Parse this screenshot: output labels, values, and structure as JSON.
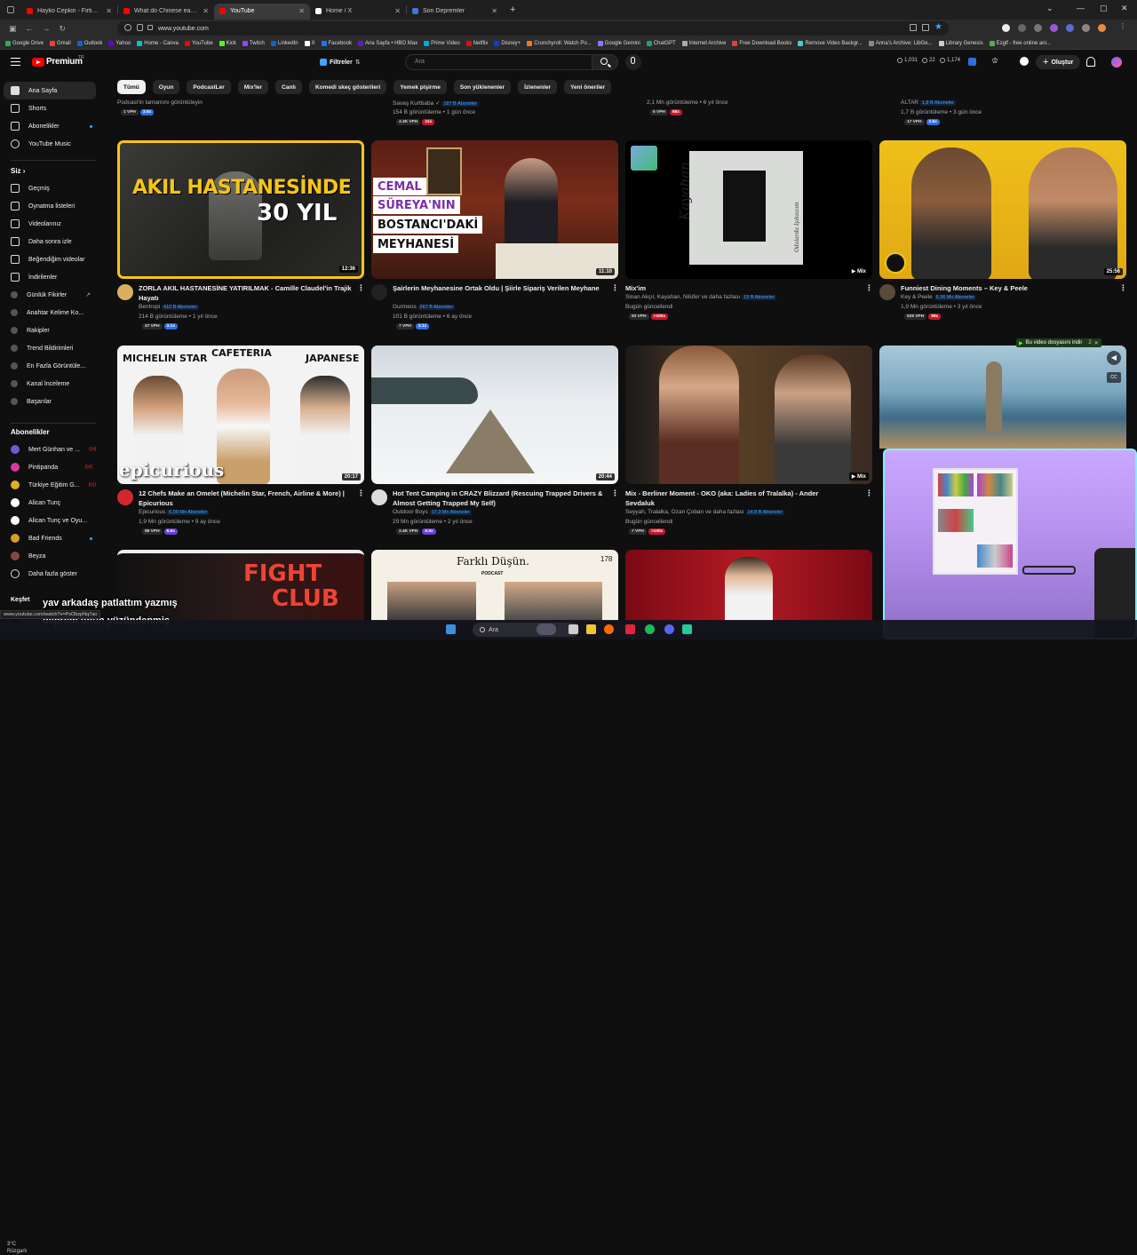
{
  "browser": {
    "tabs": [
      {
        "label": "Hayko Cepkin - Firtinam - YouTu",
        "favicon_color": "#ff0000",
        "active": false
      },
      {
        "label": "What do Chinese eat for Breakf",
        "favicon_color": "#ff0000",
        "active": false
      },
      {
        "label": "YouTube",
        "favicon_color": "#ff0000",
        "active": true
      },
      {
        "label": "Home / X",
        "favicon_color": "#ffffff",
        "active": false
      },
      {
        "label": "Son Depremler",
        "favicon_color": "#3a7bd5",
        "active": false
      }
    ],
    "new_tab": "+",
    "url": "www.youtube.com",
    "bookmarks": [
      {
        "label": "Google Drive",
        "color": "#34a853"
      },
      {
        "label": "Gmail",
        "color": "#ea4335"
      },
      {
        "label": "Outlook",
        "color": "#0a64d6"
      },
      {
        "label": "Yahoo",
        "color": "#6001d2"
      },
      {
        "label": "Home - Canva",
        "color": "#00c4cc"
      },
      {
        "label": "YouTube",
        "color": "#ff0000"
      },
      {
        "label": "Kick",
        "color": "#53fc18"
      },
      {
        "label": "Twitch",
        "color": "#9146ff"
      },
      {
        "label": "LinkedIn",
        "color": "#0a66c2"
      },
      {
        "label": "X",
        "color": "#ffffff"
      },
      {
        "label": "Facebook",
        "color": "#1877f2"
      },
      {
        "label": "Ana Sayfa • HBO Max",
        "color": "#5822b4"
      },
      {
        "label": "Prime Video",
        "color": "#00a8e1"
      },
      {
        "label": "Netflix",
        "color": "#e50914"
      },
      {
        "label": "Disney+",
        "color": "#113ccf"
      },
      {
        "label": "Crunchyroll: Watch Po...",
        "color": "#f47521"
      },
      {
        "label": "Google Gemini",
        "color": "#8e75ff"
      },
      {
        "label": "ChatGPT",
        "color": "#10a37f"
      },
      {
        "label": "Internet Archive",
        "color": "#aaaaaa"
      },
      {
        "label": "Free Download Books",
        "color": "#e04040"
      },
      {
        "label": "Remove Video Backgr...",
        "color": "#4cc"
      },
      {
        "label": "Anna's Archive: LibGe...",
        "color": "#888888"
      },
      {
        "label": "Library Genesis",
        "color": "#cccccc"
      },
      {
        "label": "Ezgif - free online ani...",
        "color": "#55aa55"
      }
    ]
  },
  "header": {
    "logo": "Premium",
    "country": "TR",
    "filters_label": "Filtreler",
    "search_placeholder": "Ara",
    "stats": [
      "1,031",
      "22",
      "1,174"
    ],
    "create_label": "Oluştur"
  },
  "sidebar": {
    "main": [
      {
        "label": "Ana Sayfa",
        "active": true
      },
      {
        "label": "Shorts"
      },
      {
        "label": "Abonelikler"
      },
      {
        "label": "YouTube Music"
      }
    ],
    "you_header": "Siz",
    "you_items": [
      {
        "label": "Geçmiş"
      },
      {
        "label": "Oynatma listeleri"
      },
      {
        "label": "Videolarınız"
      },
      {
        "label": "Daha sonra izle"
      },
      {
        "label": "Beğendiğim videolar"
      },
      {
        "label": "İndirilenler"
      },
      {
        "label": "Günlük Fikirler"
      },
      {
        "label": "Anahtar Kelime Ko..."
      },
      {
        "label": "Rakipler"
      },
      {
        "label": "Trend Bildirimleri"
      },
      {
        "label": "En Fazla Görüntüle..."
      },
      {
        "label": "Kanal İnceleme"
      },
      {
        "label": "Başarılar"
      }
    ],
    "subs_header": "Abonelikler",
    "subs": [
      {
        "label": "Mert Günhan ve ...",
        "color": "#6b5bd6",
        "live": true
      },
      {
        "label": "Pintipanda",
        "color": "#d63aa0",
        "live": true
      },
      {
        "label": "Türkiye Eğitim G...",
        "color": "#e0b020",
        "live": true
      },
      {
        "label": "Alican Tunç",
        "color": "#ffffff",
        "live": false
      },
      {
        "label": "Alican Tunç ve Oyu...",
        "color": "#ffffff",
        "live": false
      },
      {
        "label": "Bad Friends",
        "color": "#d4a020",
        "live": false,
        "dot": true
      },
      {
        "label": "Beyza",
        "color": "#884444",
        "live": false
      },
      {
        "label": "Daha fazla göster",
        "color": "",
        "live": false
      }
    ],
    "explore": "Keşfet"
  },
  "chips": [
    "Tümü",
    "Oyun",
    "PodcastLer",
    "Mix'ler",
    "Canlı",
    "Komedi skeç gösterileri",
    "Yemek pişirme",
    "Son yüklenenler",
    "İzlenenler",
    "Yeni öneriler"
  ],
  "prev_row": [
    {
      "line1": "Podcast'in tamamını görüntüleyin",
      "line2": "",
      "vph": "1 VPH",
      "badge": "3.5x",
      "badge_color": "blue"
    },
    {
      "line1": "Savaş Kurtbaba",
      "subs": "187 B Aboneler",
      "line2": "154 B görüntüleme • 1 gün önce",
      "vph": "4.3K VPH",
      "badge": "11x",
      "badge_color": "red"
    },
    {
      "line1": "2,1 Mn görüntüleme • 6 yıl önce",
      "line2": "",
      "vph": "5 VPH",
      "badge": "68x",
      "badge_color": "red"
    },
    {
      "line1": "ALTAR",
      "subs": "1,8 B Aboneler",
      "line2": "1,7 B görüntüleme • 3 gün önce",
      "vph": "17 VPH",
      "badge": "2.5x",
      "badge_color": "blue"
    }
  ],
  "videos": [
    {
      "title": "ZORLA AKIL HASTANESİNE YATIRILMAK - Camille Claudel'in Trajik Hayatı",
      "channel": "Bentropi",
      "subs": "410 B Aboneler",
      "stats": "214 B görüntüleme • 1 yıl önce",
      "vph": "47 VPH",
      "badge": "3.1x",
      "badge_color": "blue",
      "duration": "12:36",
      "thumb_text": [
        "AKIL HASTANESİNDE",
        "30 YIL"
      ],
      "avatar_color": "#d8b060"
    },
    {
      "title": "Şairlerin Meyhanesine Ortak Oldu | Şiirle Sipariş Verilen Meyhane",
      "channel": "Gurmeos",
      "subs": "267 B Aboneler",
      "stats": "101 B görüntüleme • 6 ay önce",
      "vph": "7 VPH",
      "badge": "3.1x",
      "badge_color": "blue",
      "duration": "11:10",
      "thumb_text": [
        "CEMAL",
        "SÜREYA'NIN",
        "BOSTANCI'DAKİ",
        "MEYHANESİ"
      ],
      "avatar_color": "#222222"
    },
    {
      "title": "Mix'im",
      "channel": "Sinan Akçıl, Kayahan, Nilüfer ve daha fazlası",
      "subs": "15 B Aboneler",
      "stats": "Bugün güncellendi",
      "vph": "93 VPH",
      "badge": ">100x",
      "badge_color": "red",
      "duration": "Mix",
      "thumb_text": [
        "Kayahan",
        "Odalarda Işıksızım"
      ],
      "avatar_color": ""
    },
    {
      "title": "Funniest Dining Moments – Key & Peele",
      "channel": "Key & Peele",
      "subs": "6,36 Mn Aboneler",
      "stats": "1,9 Mn görüntüleme • 3 yıl önce",
      "vph": "525 VPH",
      "badge": "99x",
      "badge_color": "red",
      "duration": "25:56",
      "thumb_text": [],
      "avatar_color": "#5a4a3a"
    },
    {
      "title": "12 Chefs Make an Omelet (Michelin Star, French, Airline & More) | Epicurious",
      "channel": "Epicurious",
      "subs": "6,09 Mn Aboneler",
      "stats": "1,9 Mn görüntüleme • 9 ay önce",
      "vph": "88 VPH",
      "badge": "6.6x",
      "badge_color": "purple",
      "duration": "20:17",
      "thumb_text": [
        "MICHELIN STAR",
        "CAFETERIA",
        "JAPANESE",
        "epicurious"
      ],
      "avatar_color": "#d4262e"
    },
    {
      "title": "Hot Tent Camping in CRAZY Blizzard (Rescuing Trapped Drivers & Almost Getting Trapped My Self)",
      "channel": "Outdoor Boys",
      "subs": "17,3 Mn Aboneler",
      "stats": "29 Mn görüntüleme • 2 yıl önce",
      "vph": "2.4K VPH",
      "badge": "6.5x",
      "badge_color": "purple",
      "duration": "20:44",
      "thumb_text": [],
      "avatar_color": "#dddddd"
    },
    {
      "title": "Mix - Berliner Moment - OKO (aka: Ladies of Tralalka) - Ander Sevdaluk",
      "channel": "Seyyah, Tralalka, Ozan Çoban ve daha fazlası",
      "subs": "14,8 B Aboneler",
      "stats": "Bugün güncellendi",
      "vph": "7 VPH",
      "badge": ">100x",
      "badge_color": "red",
      "duration": "Mix",
      "thumb_text": [],
      "avatar_color": ""
    }
  ],
  "bottom_row": [
    {
      "thumb_text": [
        "FIGHT",
        "CLUB"
      ]
    },
    {
      "thumb_text": [
        "Farklı Düşün.",
        "PODCAST",
        "178"
      ]
    },
    {
      "thumb_text": []
    }
  ],
  "download_bar": "Bu video dosyasını indir",
  "subtitles": [
    "yav arkadaş patlattım yazmış",
    "deprem onun yüzündenmiş"
  ],
  "status_url": "www.youtube.com/watch?v=PsObzpNq7ao",
  "weather": {
    "temp": "3°C",
    "label": "Rüzgarlı"
  },
  "taskbar": {
    "search": "Ara"
  }
}
